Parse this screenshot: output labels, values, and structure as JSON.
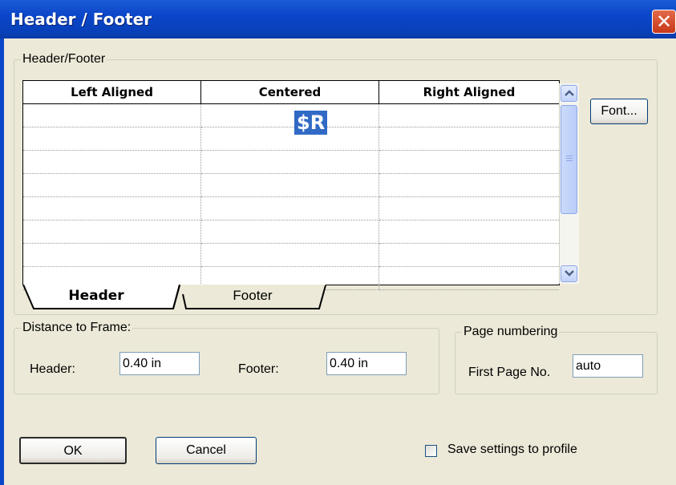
{
  "window": {
    "title": "Header / Footer",
    "close_glyph": "✕"
  },
  "header_footer": {
    "group_label": "Header/Footer",
    "columns": [
      "Left Aligned",
      "Centered",
      "Right Aligned"
    ],
    "selected_cell_text": "$R",
    "font_button": "Font...",
    "tabs": [
      "Header",
      "Footer"
    ]
  },
  "distance": {
    "group_label": "Distance to Frame:",
    "header_label": "Header:",
    "header_value": "0.40 in",
    "footer_label": "Footer:",
    "footer_value": "0.40 in"
  },
  "page_numbering": {
    "group_label": "Page numbering",
    "first_page_label": "First Page No.",
    "first_page_value": "auto"
  },
  "buttons": {
    "ok": "OK",
    "cancel": "Cancel"
  },
  "save_profile": {
    "label": "Save settings to profile",
    "checked": false
  },
  "icons": {
    "close": "close-icon",
    "scroll_up": "chevron-up-icon",
    "scroll_down": "chevron-down-icon"
  },
  "colors": {
    "titlebar": "#0a46c9",
    "selection": "#316ac5",
    "dialog_bg": "#ece9d8"
  }
}
